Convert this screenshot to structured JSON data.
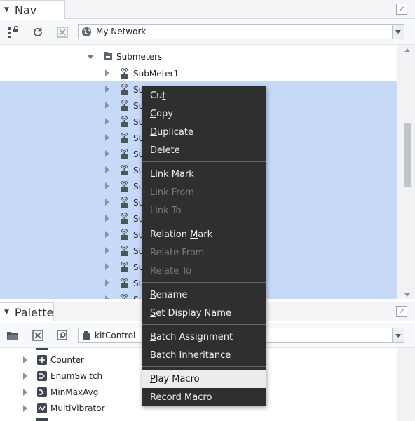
{
  "nav": {
    "title": "Nav",
    "toolbar": {
      "network_combo": "My Network"
    },
    "tree": {
      "parent": "Submeters",
      "items": [
        {
          "label": "SubMeter1",
          "selected": false
        },
        {
          "label": "Su",
          "selected": true
        },
        {
          "label": "Su",
          "selected": true
        },
        {
          "label": "Su",
          "selected": true
        },
        {
          "label": "Su",
          "selected": true
        },
        {
          "label": "Su",
          "selected": true
        },
        {
          "label": "Su",
          "selected": true
        },
        {
          "label": "Su",
          "selected": true
        },
        {
          "label": "Su",
          "selected": true
        },
        {
          "label": "Su",
          "selected": true
        },
        {
          "label": "Su",
          "selected": true
        },
        {
          "label": "Su",
          "selected": true
        },
        {
          "label": "Su",
          "selected": true
        },
        {
          "label": "Su",
          "selected": true
        },
        {
          "label": "Su",
          "selected": true
        }
      ]
    }
  },
  "context_menu": {
    "groups": [
      [
        {
          "label": "Cut",
          "mnemonic": "t",
          "disabled": false
        },
        {
          "label": "Copy",
          "mnemonic": "C",
          "disabled": false
        },
        {
          "label": "Duplicate",
          "mnemonic": "D",
          "disabled": false
        },
        {
          "label": "Delete",
          "mnemonic": "e",
          "disabled": false
        }
      ],
      [
        {
          "label": "Link Mark",
          "mnemonic": "L",
          "disabled": false
        },
        {
          "label": "Link From",
          "disabled": true
        },
        {
          "label": "Link To",
          "disabled": true
        }
      ],
      [
        {
          "label": "Relation Mark",
          "mnemonic": "M",
          "disabled": false
        },
        {
          "label": "Relate From",
          "disabled": true
        },
        {
          "label": "Relate To",
          "disabled": true
        }
      ],
      [
        {
          "label": "Rename",
          "mnemonic": "R",
          "disabled": false
        },
        {
          "label": "Set Display Name",
          "mnemonic": "S",
          "disabled": false
        }
      ],
      [
        {
          "label": "Batch Assignment",
          "mnemonic": "B",
          "disabled": false
        },
        {
          "label": "Batch Inheritance",
          "mnemonic": "I",
          "disabled": false
        }
      ],
      [
        {
          "label": "Play Macro",
          "mnemonic": "P",
          "disabled": false,
          "hover": true
        },
        {
          "label": "Record Macro",
          "disabled": false
        }
      ]
    ]
  },
  "palette": {
    "title": "Palette",
    "toolbar": {
      "module_combo": "kitControl"
    },
    "items": [
      {
        "label": "Counter",
        "icon": "counter-icon"
      },
      {
        "label": "EnumSwitch",
        "icon": "enum-switch-icon"
      },
      {
        "label": "MinMaxAvg",
        "icon": "min-max-avg-icon"
      },
      {
        "label": "MultiVibrator",
        "icon": "multivibrator-icon"
      }
    ]
  },
  "colors": {
    "selection": "#c6d9f7",
    "menu_bg": "#2f2f2f",
    "menu_text": "#f2f2f2",
    "menu_disabled": "#7a7a7a"
  }
}
